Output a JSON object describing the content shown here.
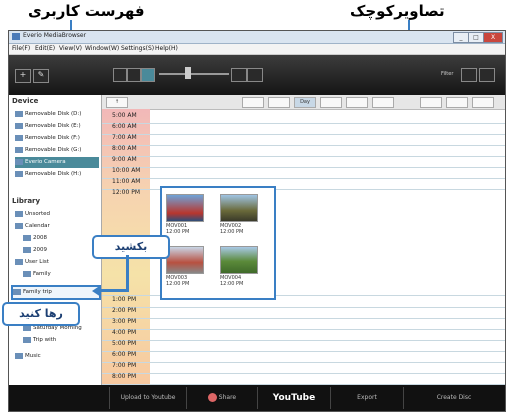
{
  "annotations": {
    "playlist": "فهرست کاربری",
    "thumbnails": "تصاویرکوچک",
    "drag": "بکشید",
    "drop": "رها کنید"
  },
  "window": {
    "title": "Everio MediaBrowser",
    "buttons": [
      "_",
      "□",
      "X"
    ]
  },
  "menu": [
    "File(F)",
    "Edit(E)",
    "View(V)",
    "Window(W)",
    "Settings(S)",
    "Help(H)"
  ],
  "toolbar": {
    "add": "+",
    "tools": "✎",
    "view_label": "Filter",
    "zoom": "Zoom"
  },
  "sidebar": {
    "device_header": "Device",
    "devices": [
      "Removable Disk (D:)",
      "Removable Disk (E:)",
      "Removable Disk (F:)",
      "Removable Disk (G:)",
      "Everio Camera",
      "Removable Disk (H:)"
    ],
    "library_header": "Library",
    "library": [
      "Unsorted",
      "Calendar",
      "2008",
      "2009",
      "User List",
      "Family trip",
      "Family"
    ],
    "lower": [
      "Saturday Morning",
      "Trip with",
      "Music"
    ]
  },
  "content": {
    "nav_buttons": [
      "↑",
      "",
      "",
      "Day",
      "",
      "",
      "",
      "",
      ""
    ],
    "times_top": [
      "5:00 AM",
      "6:00 AM",
      "7:00 AM",
      "8:00 AM",
      "9:00 AM",
      "10:00 AM",
      "11:00 AM",
      "12:00 PM"
    ],
    "times_bottom": [
      "1:00 PM",
      "2:00 PM",
      "3:00 PM",
      "4:00 PM",
      "5:00 PM",
      "6:00 PM",
      "7:00 PM",
      "8:00 PM"
    ]
  },
  "thumbnails": [
    {
      "caption": "MOV001",
      "time": "12:00 PM"
    },
    {
      "caption": "MOV002",
      "time": "12:00 PM"
    },
    {
      "caption": "MOV003",
      "time": "12:00 PM"
    },
    {
      "caption": "MOV004",
      "time": "12:00 PM"
    }
  ],
  "bottom": {
    "upload": "Upload to Youtube",
    "share": "Share",
    "youtube": "YouTube",
    "export": "Export",
    "disc": "Create Disc"
  },
  "colors": {
    "accent": "#3a7fc4",
    "selected": "#4a8a9a"
  }
}
